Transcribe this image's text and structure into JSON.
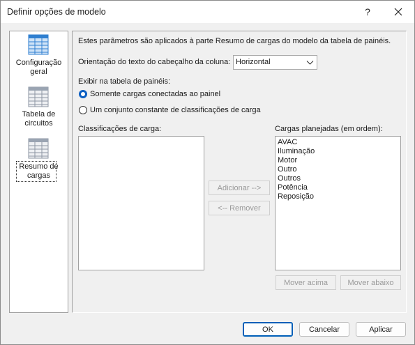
{
  "window": {
    "title": "Definir opções de modelo",
    "help_glyph": "?",
    "close_icon": "close-icon"
  },
  "sidebar": {
    "items": [
      {
        "label_line1": "Configuração",
        "label_line2": "geral",
        "icon": "grid-table-icon",
        "color": "#2f7fd0"
      },
      {
        "label_line1": "Tabela de",
        "label_line2": "circuitos",
        "icon": "grid-table-icon",
        "color": "#9aa4b2"
      },
      {
        "label_line1": "Resumo de",
        "label_line2": "cargas",
        "icon": "grid-table-icon",
        "color": "#9aa4b2",
        "selected": true
      }
    ]
  },
  "main": {
    "description": "Estes parâmetros são aplicados à parte Resumo de cargas do modelo da tabela de painéis.",
    "orientation_label": "Orientação do texto do cabeçalho da coluna:",
    "orientation_value": "Horizontal",
    "show_label": "Exibir na tabela de painéis:",
    "radio_connected": "Somente cargas conectadas ao painel",
    "radio_constant": "Um conjunto constante de classificações de carga",
    "classifications_label": "Classificações de carga:",
    "planned_label": "Cargas planejadas (em ordem):",
    "planned_items": [
      "AVAC",
      "Iluminação",
      "Motor",
      "Outro",
      "Outros",
      "Potência",
      "Reposição"
    ],
    "add_button": "Adicionar -->",
    "remove_button": "<-- Remover",
    "move_up_button": "Mover acima",
    "move_down_button": "Mover abaixo"
  },
  "footer": {
    "ok": "OK",
    "cancel": "Cancelar",
    "apply": "Aplicar"
  },
  "colors": {
    "accent": "#005fb8",
    "radio_selected": "#0b5fc2"
  }
}
